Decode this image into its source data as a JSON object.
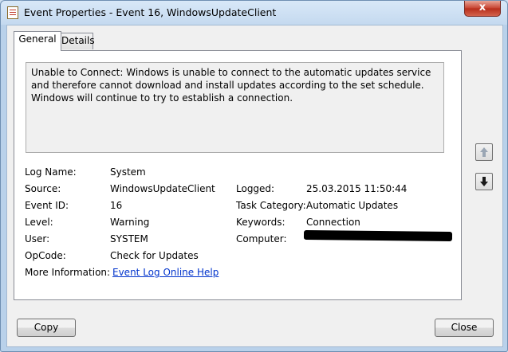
{
  "window": {
    "title": "Event Properties - Event 16, WindowsUpdateClient",
    "close_glyph": "x"
  },
  "tabs": [
    {
      "label": "General"
    },
    {
      "label": "Details"
    }
  ],
  "description": "Unable to Connect: Windows is unable to connect to the automatic updates service and therefore cannot download and install updates according to the set schedule. Windows will continue to try to establish a connection.",
  "fields": {
    "log_name": {
      "label": "Log Name:",
      "value": "System"
    },
    "source": {
      "label": "Source:",
      "value": "WindowsUpdateClient"
    },
    "event_id": {
      "label": "Event ID:",
      "value": "16"
    },
    "level": {
      "label": "Level:",
      "value": "Warning"
    },
    "user": {
      "label": "User:",
      "value": "SYSTEM"
    },
    "opcode": {
      "label": "OpCode:",
      "value": "Check for Updates"
    },
    "more_info": {
      "label": "More Information:",
      "value": "Event Log Online Help"
    },
    "logged": {
      "label": "Logged:",
      "value": "25.03.2015 11:50:44"
    },
    "task_category": {
      "label": "Task Category:",
      "value": "Automatic Updates"
    },
    "keywords": {
      "label": "Keywords:",
      "value": "Connection"
    },
    "computer": {
      "label": "Computer:",
      "value": ""
    }
  },
  "buttons": {
    "copy": "Copy",
    "close": "Close"
  },
  "icons": {
    "app": "event-viewer-icon",
    "up": "up-arrow-icon",
    "down": "down-arrow-icon"
  }
}
